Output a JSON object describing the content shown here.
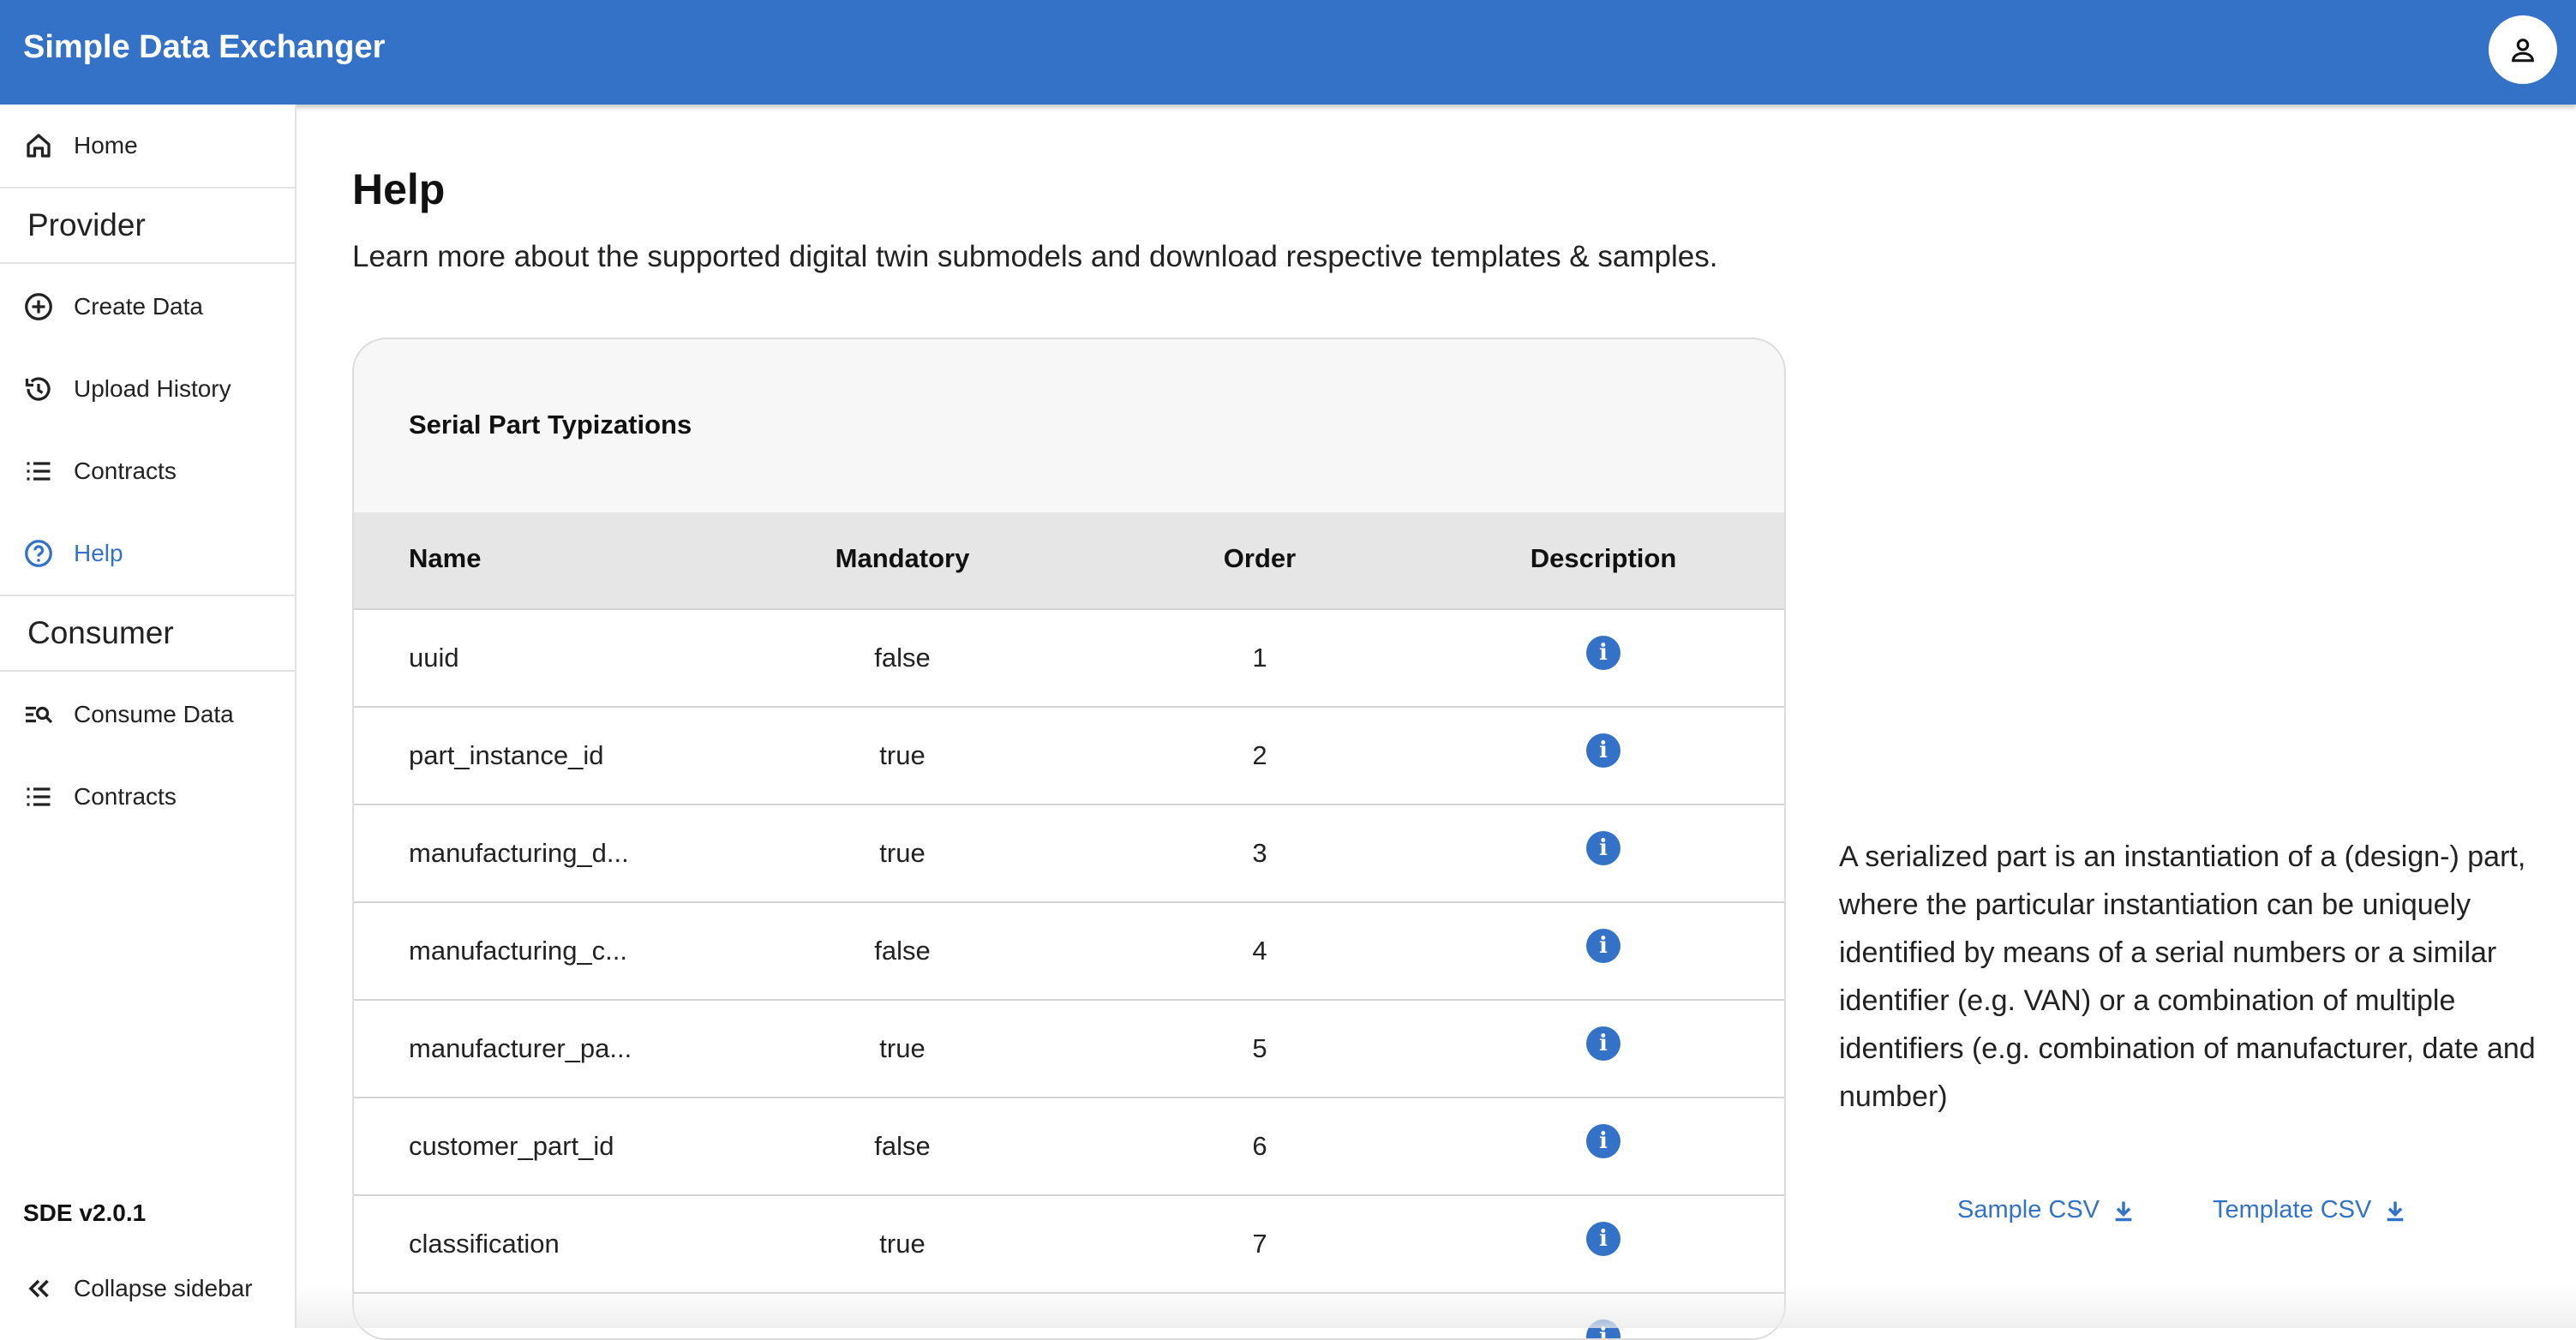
{
  "app": {
    "title": "Simple Data Exchanger"
  },
  "sidebar": {
    "home": "Home",
    "provider_section": "Provider",
    "provider_items": [
      {
        "label": "Create Data",
        "icon": "add-circle-icon"
      },
      {
        "label": "Upload History",
        "icon": "history-icon"
      },
      {
        "label": "Contracts",
        "icon": "list-icon"
      },
      {
        "label": "Help",
        "icon": "help-circle-icon",
        "active": true
      }
    ],
    "consumer_section": "Consumer",
    "consumer_items": [
      {
        "label": "Consume Data",
        "icon": "search-list-icon"
      },
      {
        "label": "Contracts",
        "icon": "list-icon"
      }
    ],
    "version": "SDE v2.0.1",
    "collapse": "Collapse sidebar"
  },
  "main": {
    "title": "Help",
    "subtitle": "Learn more about the supported digital twin submodels and download respective templates & samples."
  },
  "card": {
    "title": "Serial Part Typizations",
    "columns": [
      "Name",
      "Mandatory",
      "Order",
      "Description"
    ],
    "rows": [
      {
        "name": "uuid",
        "mandatory": "false",
        "order": "1"
      },
      {
        "name": "part_instance_id",
        "mandatory": "true",
        "order": "2"
      },
      {
        "name": "manufacturing_d...",
        "mandatory": "true",
        "order": "3"
      },
      {
        "name": "manufacturing_c...",
        "mandatory": "false",
        "order": "4"
      },
      {
        "name": "manufacturer_pa...",
        "mandatory": "true",
        "order": "5"
      },
      {
        "name": "customer_part_id",
        "mandatory": "false",
        "order": "6"
      },
      {
        "name": "classification",
        "mandatory": "true",
        "order": "7"
      }
    ]
  },
  "description": "A serialized part is an instantiation of a (design-) part, where the particular instantiation can be uniquely identified by means of a serial numbers or a similar identifier (e.g. VAN) or a combination of multiple identifiers (e.g. combination of manufacturer, date and number)",
  "downloads": {
    "sample": "Sample CSV",
    "template": "Template CSV"
  },
  "colors": {
    "accent": "#3372c7",
    "header_bg": "#3372c7"
  }
}
